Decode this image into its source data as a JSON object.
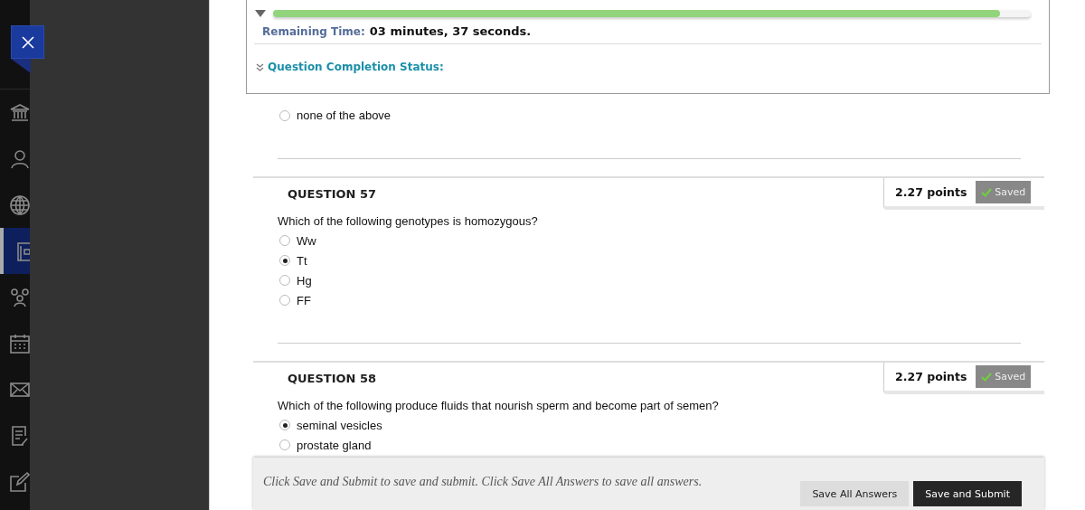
{
  "sidebar": {
    "nav_items": [
      {
        "selected": false
      },
      {
        "selected": false
      },
      {
        "selected": false
      },
      {
        "selected": true
      },
      {
        "selected": false
      },
      {
        "selected": false
      },
      {
        "selected": false
      },
      {
        "selected": false
      },
      {
        "selected": false
      }
    ]
  },
  "status_panel": {
    "timer": {
      "level": 0.96,
      "label": "Remaining Time:",
      "value": "03 minutes, 37 seconds."
    },
    "completion_label": "Question Completion Status:"
  },
  "previous_options": [
    {
      "text": "none of the above",
      "selected": false
    }
  ],
  "questions": [
    {
      "title": "QUESTION 57",
      "points": "2.27 points",
      "status": "Saved",
      "prompt": "Which of the following genotypes is homozygous?",
      "options": [
        {
          "text": "Ww",
          "selected": false
        },
        {
          "text": "Tt",
          "selected": true
        },
        {
          "text": "Hg",
          "selected": false
        },
        {
          "text": "FF",
          "selected": false
        }
      ]
    },
    {
      "title": "QUESTION 58",
      "points": "2.27 points",
      "status": "Saved",
      "prompt": "Which of the following produce fluids that nourish sperm and become part of semen?",
      "options": [
        {
          "text": "seminal vesicles",
          "selected": true
        },
        {
          "text": "prostate gland",
          "selected": false
        }
      ]
    }
  ],
  "footer": {
    "instructions": "Click Save and Submit to save and submit. Click Save All Answers to save all answers.",
    "buttons": [
      {
        "label": "Save All Answers",
        "kind": "secondary"
      },
      {
        "label": "Save and Submit",
        "kind": "primary"
      }
    ]
  }
}
